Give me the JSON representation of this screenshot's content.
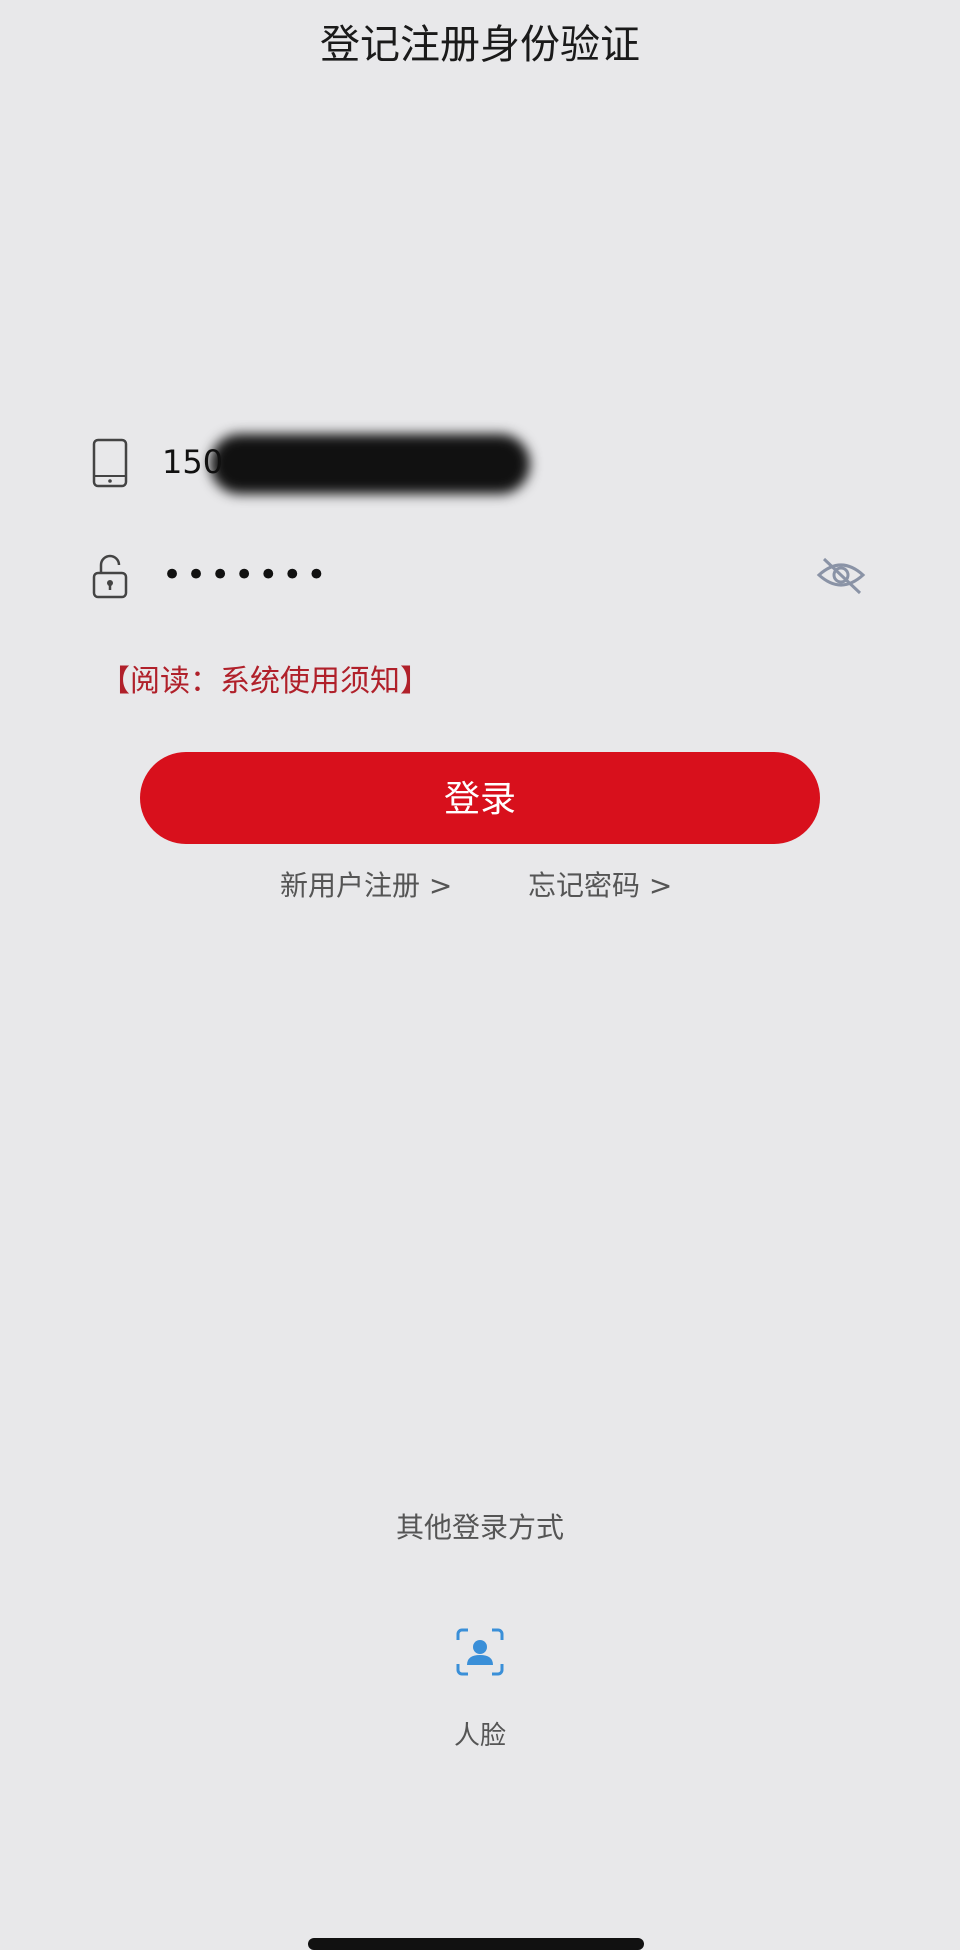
{
  "header": {
    "title": "登记注册身份验证"
  },
  "phone_field": {
    "icon": "mobile-phone-icon",
    "visible_value": "1504"
  },
  "password_field": {
    "icon": "lock-icon",
    "masked_value": "•••••••",
    "toggle_icon": "eye-visibility-icon"
  },
  "notice": {
    "label": "【阅读：系统使用须知】"
  },
  "login_button": {
    "label": "登录",
    "color": "#d8101c"
  },
  "links": {
    "register": "新用户注册 >",
    "forgot_password": "忘记密码 >"
  },
  "other_login": {
    "heading": "其他登录方式",
    "face": {
      "icon": "face-recognition-icon",
      "label": "人脸"
    }
  }
}
